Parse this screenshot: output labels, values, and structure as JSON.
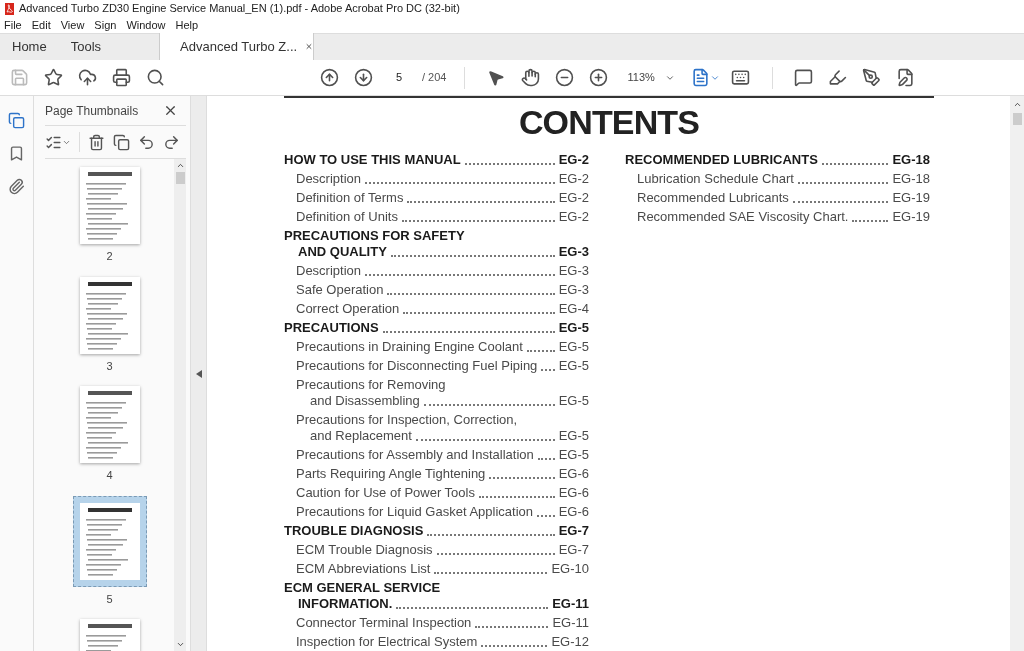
{
  "window": {
    "title": "Advanced Turbo ZD30 Engine Service Manual_EN (1).pdf - Adobe Acrobat Pro DC (32-bit)"
  },
  "menu": [
    "File",
    "Edit",
    "View",
    "Sign",
    "Window",
    "Help"
  ],
  "tabs": [
    {
      "label": "Home",
      "selected": false,
      "kind": "nav"
    },
    {
      "label": "Tools",
      "selected": false,
      "kind": "nav"
    },
    {
      "label": "Advanced Turbo Z...",
      "selected": true,
      "kind": "document"
    }
  ],
  "toolbar": {
    "page": "5",
    "page_count": "/ 204",
    "zoom": "113%"
  },
  "thumbnails_panel": {
    "title": "Page Thumbnails",
    "pages": [
      {
        "label": "2",
        "selected": false
      },
      {
        "label": "3",
        "selected": false
      },
      {
        "label": "4",
        "selected": false
      },
      {
        "label": "5",
        "selected": true
      },
      {
        "selected": false
      }
    ]
  },
  "document": {
    "title": "CONTENTS",
    "columns": [
      [
        {
          "kind": "heading",
          "lines": [
            "HOW TO USE THIS MANUAL"
          ],
          "page": "EG-2"
        },
        {
          "kind": "item",
          "lines": [
            "Description"
          ],
          "page": "EG-2"
        },
        {
          "kind": "item",
          "lines": [
            "Definition of Terms"
          ],
          "page": "EG-2"
        },
        {
          "kind": "item",
          "lines": [
            "Definition of Units"
          ],
          "page": "EG-2"
        },
        {
          "kind": "heading",
          "lines": [
            "PRECAUTIONS FOR SAFETY",
            "AND QUALITY"
          ],
          "page": "EG-3"
        },
        {
          "kind": "item",
          "lines": [
            "Description"
          ],
          "page": "EG-3"
        },
        {
          "kind": "item",
          "lines": [
            "Safe Operation"
          ],
          "page": "EG-3"
        },
        {
          "kind": "item",
          "lines": [
            "Correct Operation"
          ],
          "page": "EG-4"
        },
        {
          "kind": "heading",
          "lines": [
            "PRECAUTIONS"
          ],
          "page": "EG-5"
        },
        {
          "kind": "item",
          "lines": [
            "Precautions in Draining Engine Coolant"
          ],
          "page": "EG-5"
        },
        {
          "kind": "item",
          "lines": [
            "Precautions for Disconnecting Fuel Piping"
          ],
          "page": "EG-5"
        },
        {
          "kind": "item",
          "lines": [
            "Precautions for Removing",
            "and Disassembling"
          ],
          "page": "EG-5"
        },
        {
          "kind": "item",
          "lines": [
            "Precautions for Inspection, Correction,",
            "and Replacement"
          ],
          "page": "EG-5"
        },
        {
          "kind": "item",
          "lines": [
            "Precautions for Assembly and Installation"
          ],
          "page": "EG-5"
        },
        {
          "kind": "item",
          "lines": [
            "Parts Requiring Angle Tightening"
          ],
          "page": "EG-6"
        },
        {
          "kind": "item",
          "lines": [
            "Caution for Use of Power Tools"
          ],
          "page": "EG-6"
        },
        {
          "kind": "item",
          "lines": [
            "Precautions for Liquid Gasket Application"
          ],
          "page": "EG-6"
        },
        {
          "kind": "heading",
          "lines": [
            "TROUBLE DIAGNOSIS"
          ],
          "page": "EG-7"
        },
        {
          "kind": "item",
          "lines": [
            "ECM Trouble Diagnosis"
          ],
          "page": "EG-7"
        },
        {
          "kind": "item",
          "lines": [
            "ECM Abbreviations List"
          ],
          "page": "EG-10"
        },
        {
          "kind": "heading",
          "lines": [
            "ECM GENERAL SERVICE",
            "INFORMATION."
          ],
          "page": "EG-11"
        },
        {
          "kind": "item",
          "lines": [
            "Connector Terminal Inspection"
          ],
          "page": "EG-11"
        },
        {
          "kind": "item",
          "lines": [
            "Inspection for Electrical System"
          ],
          "page": "EG-12"
        }
      ],
      [
        {
          "kind": "heading",
          "lines": [
            "RECOMMENDED LUBRICANTS"
          ],
          "page": "EG-18"
        },
        {
          "kind": "item",
          "lines": [
            "Lubrication Schedule Chart"
          ],
          "page": "EG-18"
        },
        {
          "kind": "item",
          "lines": [
            "Recommended Lubricants"
          ],
          "page": "EG-19"
        },
        {
          "kind": "item",
          "lines": [
            "Recommended SAE Viscosity Chart."
          ],
          "page": "EG-19"
        }
      ]
    ]
  }
}
